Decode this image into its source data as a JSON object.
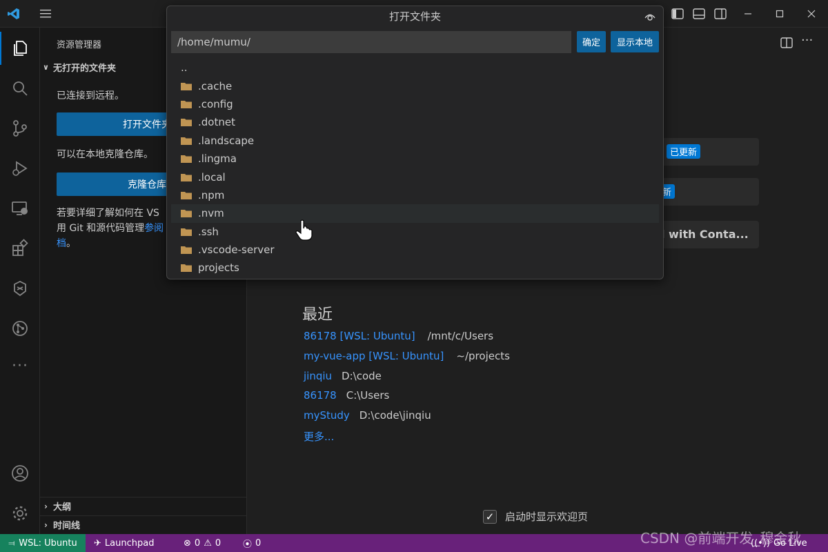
{
  "colors": {
    "accent": "#0e639c",
    "link": "#3794ff",
    "statusbar": "#68217a",
    "remote": "#16825d",
    "badge": "#0078d4"
  },
  "titlebar": {
    "icons": [
      "vscode-logo-icon",
      "menu-icon",
      "toggle-sidebar-icon",
      "toggle-panel-icon",
      "toggle-secondary-sidebar-icon",
      "minimize-icon",
      "maximize-icon",
      "close-icon"
    ]
  },
  "sidebar": {
    "title": "资源管理器",
    "section": "无打开的文件夹",
    "connected_text": "已连接到远程。",
    "open_folder_button": "打开文件夹",
    "clone_text": "可以在本地克隆仓库。",
    "clone_button": "克隆仓库",
    "learn_text_1": "若要详细了解如何在 VS",
    "learn_text_2": "用 Git 和源代码管理",
    "learn_link": "参阅",
    "learn_text_3": "档",
    "learn_text_end": "。",
    "outline": "大纲",
    "timeline": "时间线"
  },
  "editor": {
    "badge_updated": "已更新",
    "badge_new": "新",
    "container_text": "l with Conta...",
    "recent_title": "最近",
    "recent": [
      {
        "name": "86178 [WSL: Ubuntu]",
        "path": "/mnt/c/Users"
      },
      {
        "name": "my-vue-app [WSL: Ubuntu]",
        "path": "~/projects"
      },
      {
        "name": "jinqiu",
        "path": "D:\\code"
      },
      {
        "name": "86178",
        "path": "C:\\Users"
      },
      {
        "name": "myStudy",
        "path": "D:\\code\\jinqiu"
      }
    ],
    "more": "更多...",
    "startup_checkbox": "启动时显示欢迎页"
  },
  "quickpick": {
    "title": "打开文件夹",
    "path": "/home/mumu/",
    "confirm": "确定",
    "show_local": "显示本地",
    "items": [
      "..",
      ".cache",
      ".config",
      ".dotnet",
      ".landscape",
      ".lingma",
      ".local",
      ".npm",
      ".nvm",
      ".ssh",
      ".vscode-server",
      "projects"
    ],
    "highlighted_index": 8
  },
  "statusbar": {
    "remote": "WSL: Ubuntu",
    "launchpad": "Launchpad",
    "errors": "0",
    "warnings": "0",
    "ports": "0",
    "golive": "Go Live"
  },
  "watermark": "CSDN @前端开发_穆金秋"
}
